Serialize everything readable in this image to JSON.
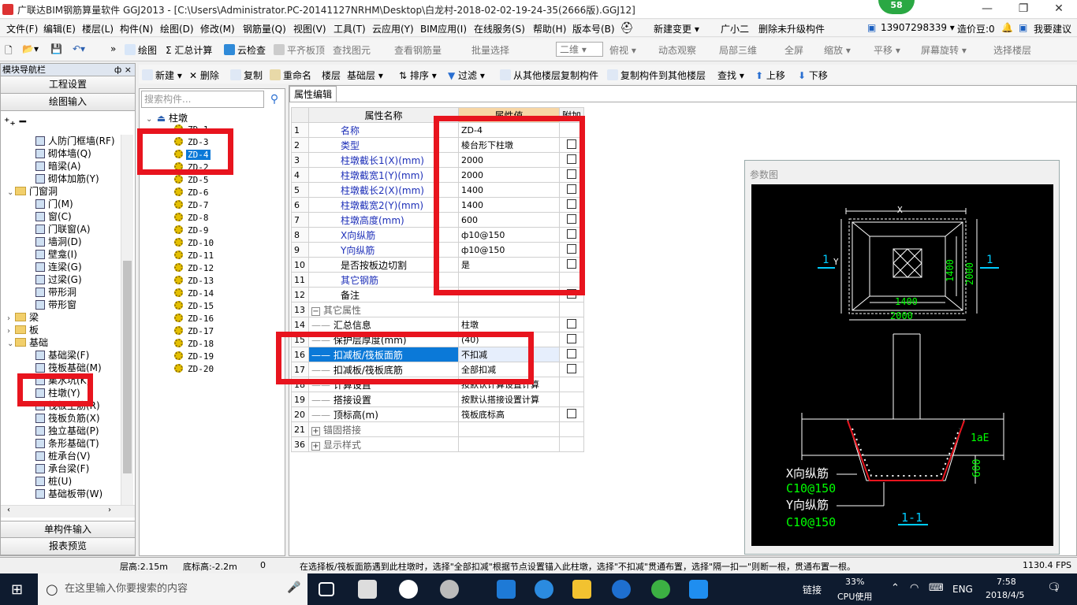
{
  "title_bar": {
    "title": "广联达BIM钢筋算量软件 GGJ2013 - [C:\\Users\\Administrator.PC-20141127NRHM\\Desktop\\白龙村-2018-02-02-19-24-35(2666版).GGJ12]",
    "badge": "58"
  },
  "menu": [
    "文件(F)",
    "编辑(E)",
    "楼层(L)",
    "构件(N)",
    "绘图(D)",
    "修改(M)",
    "钢筋量(Q)",
    "视图(V)",
    "工具(T)",
    "云应用(Y)",
    "BIM应用(I)",
    "在线服务(S)",
    "帮助(H)",
    "版本号(B)",
    "新建变更 ▾",
    "广小二",
    "删除未升级构件",
    "13907298339 ▾",
    "造价豆:0",
    "我要建议"
  ],
  "toolbar1": [
    "绘图",
    "Σ 汇总计算",
    "云检查",
    "平齐板顶",
    "查找图元",
    "查看钢筋量",
    "批量选择",
    "二维 ▾",
    "俯视 ▾",
    "动态观察",
    "局部三维",
    "全屏",
    "缩放 ▾",
    "平移 ▾",
    "屏幕旋转 ▾",
    "选择楼层"
  ],
  "toolbar2": [
    "新建 ▾",
    "删除",
    "复制",
    "重命名",
    "楼层",
    "基础层",
    "排序 ▾",
    "过滤 ▾",
    "从其他楼层复制构件",
    "复制构件到其他楼层",
    "查找 ▾",
    "上移",
    "下移"
  ],
  "left_nav": {
    "header": "模块导航栏",
    "pin": "ф ×",
    "buttons": [
      "工程设置",
      "绘图输入"
    ],
    "bottom_buttons": [
      "单构件输入",
      "报表预览"
    ],
    "tree": [
      {
        "label": "人防门框墙(RF)",
        "level": 2,
        "type": "item"
      },
      {
        "label": "砌体墙(Q)",
        "level": 2,
        "type": "item"
      },
      {
        "label": "暗梁(A)",
        "level": 2,
        "type": "item"
      },
      {
        "label": "砌体加筋(Y)",
        "level": 2,
        "type": "item"
      },
      {
        "label": "门窗洞",
        "level": 1,
        "type": "folder",
        "expand": "⌄"
      },
      {
        "label": "门(M)",
        "level": 2,
        "type": "item"
      },
      {
        "label": "窗(C)",
        "level": 2,
        "type": "item"
      },
      {
        "label": "门联窗(A)",
        "level": 2,
        "type": "item"
      },
      {
        "label": "墙洞(D)",
        "level": 2,
        "type": "item"
      },
      {
        "label": "壁龛(I)",
        "level": 2,
        "type": "item"
      },
      {
        "label": "连梁(G)",
        "level": 2,
        "type": "item"
      },
      {
        "label": "过梁(G)",
        "level": 2,
        "type": "item"
      },
      {
        "label": "带形洞",
        "level": 2,
        "type": "item"
      },
      {
        "label": "带形窗",
        "level": 2,
        "type": "item"
      },
      {
        "label": "梁",
        "level": 1,
        "type": "folder",
        "expand": "›"
      },
      {
        "label": "板",
        "level": 1,
        "type": "folder",
        "expand": "›"
      },
      {
        "label": "基础",
        "level": 1,
        "type": "folder",
        "expand": "⌄"
      },
      {
        "label": "基础梁(F)",
        "level": 2,
        "type": "item"
      },
      {
        "label": "筏板基础(M)",
        "level": 2,
        "type": "item"
      },
      {
        "label": "集水坑(K)",
        "level": 2,
        "type": "item"
      },
      {
        "label": "柱墩(Y)",
        "level": 2,
        "type": "item"
      },
      {
        "label": "筏板主筋(R)",
        "level": 2,
        "type": "item"
      },
      {
        "label": "筏板负筋(X)",
        "level": 2,
        "type": "item"
      },
      {
        "label": "独立基础(P)",
        "level": 2,
        "type": "item"
      },
      {
        "label": "条形基础(T)",
        "level": 2,
        "type": "item"
      },
      {
        "label": "桩承台(V)",
        "level": 2,
        "type": "item"
      },
      {
        "label": "承台梁(F)",
        "level": 2,
        "type": "item"
      },
      {
        "label": "桩(U)",
        "level": 2,
        "type": "item"
      },
      {
        "label": "基础板带(W)",
        "level": 2,
        "type": "item"
      }
    ]
  },
  "component_list": {
    "search_placeholder": "搜索构件...",
    "root": "柱墩",
    "items": [
      "ZD-1",
      "ZD-3",
      "ZD-4",
      "ZD-2",
      "ZD-5",
      "ZD-6",
      "ZD-7",
      "ZD-8",
      "ZD-9",
      "ZD-10",
      "ZD-11",
      "ZD-12",
      "ZD-13",
      "ZD-14",
      "ZD-15",
      "ZD-16",
      "ZD-17",
      "ZD-18",
      "ZD-19",
      "ZD-20"
    ],
    "selected": "ZD-4"
  },
  "property_editor": {
    "tab": "属性编辑",
    "headers": [
      "属性名称",
      "属性值",
      "附加"
    ],
    "rows": [
      {
        "num": "1",
        "name": "名称",
        "value": "ZD-4",
        "style": "blue",
        "check": false,
        "indent": 0
      },
      {
        "num": "2",
        "name": "类型",
        "value": "棱台形下柱墩",
        "style": "blue",
        "check": true,
        "indent": 0
      },
      {
        "num": "3",
        "name": "柱墩截长1(X)(mm)",
        "value": "2000",
        "style": "blue",
        "check": true,
        "indent": 0
      },
      {
        "num": "4",
        "name": "柱墩截宽1(Y)(mm)",
        "value": "2000",
        "style": "blue",
        "check": true,
        "indent": 0
      },
      {
        "num": "5",
        "name": "柱墩截长2(X)(mm)",
        "value": "1400",
        "style": "blue",
        "check": true,
        "indent": 0
      },
      {
        "num": "6",
        "name": "柱墩截宽2(Y)(mm)",
        "value": "1400",
        "style": "blue",
        "check": true,
        "indent": 0
      },
      {
        "num": "7",
        "name": "柱墩高度(mm)",
        "value": "600",
        "style": "blue",
        "check": true,
        "indent": 0
      },
      {
        "num": "8",
        "name": "X向纵筋",
        "value": "ф10@150",
        "style": "blue",
        "check": true,
        "indent": 0
      },
      {
        "num": "9",
        "name": "Y向纵筋",
        "value": "ф10@150",
        "style": "blue",
        "check": true,
        "indent": 0
      },
      {
        "num": "10",
        "name": "是否按板边切割",
        "value": "是",
        "style": "black",
        "check": true,
        "indent": 0
      },
      {
        "num": "11",
        "name": "其它钢筋",
        "value": "",
        "style": "blue",
        "check": false,
        "indent": 0
      },
      {
        "num": "12",
        "name": "备注",
        "value": "",
        "style": "black",
        "check": true,
        "indent": 0
      },
      {
        "num": "13",
        "name": "其它属性",
        "value": "",
        "style": "grey",
        "check": false,
        "indent": 0,
        "expand": "−"
      },
      {
        "num": "14",
        "name": "汇总信息",
        "value": "柱墩",
        "style": "black",
        "check": true,
        "indent": 1
      },
      {
        "num": "15",
        "name": "保护层厚度(mm)",
        "value": "(40)",
        "style": "black",
        "check": true,
        "indent": 1
      },
      {
        "num": "16",
        "name": "扣减板/筏板面筋",
        "value": "不扣减",
        "style": "black",
        "check": true,
        "indent": 1,
        "selected": true
      },
      {
        "num": "17",
        "name": "扣减板/筏板底筋",
        "value": "全部扣减",
        "style": "black",
        "check": true,
        "indent": 1
      },
      {
        "num": "18",
        "name": "计算设置",
        "value": "按默认计算设置计算",
        "style": "black",
        "check": false,
        "indent": 1
      },
      {
        "num": "19",
        "name": "搭接设置",
        "value": "按默认搭接设置计算",
        "style": "black",
        "check": false,
        "indent": 1
      },
      {
        "num": "20",
        "name": "顶标高(m)",
        "value": "筏板底标高",
        "style": "black",
        "check": true,
        "indent": 1
      },
      {
        "num": "21",
        "name": "锚固搭接",
        "value": "",
        "style": "grey",
        "check": false,
        "indent": 0,
        "expand": "+"
      },
      {
        "num": "36",
        "name": "显示样式",
        "value": "",
        "style": "grey",
        "check": false,
        "indent": 0,
        "expand": "+"
      }
    ]
  },
  "param_diagram": {
    "title": "参数图",
    "labels": {
      "x": "X",
      "y": "Y",
      "sec_left": "1",
      "sec_right": "1",
      "d1400v": "1400",
      "d2000v": "2000",
      "d1400h": "1400",
      "d2000h": "2000",
      "lae": "1aE",
      "h600": "600",
      "xbar": "X向纵筋",
      "xspec": "C10@150",
      "ybar": "Y向纵筋",
      "yspec": "C10@150",
      "section": "1-1"
    }
  },
  "status_bar": {
    "floor_height": "层高:2.15m",
    "bottom_elev": "底标高:-2.2m",
    "zero": "0",
    "hint": "在选择板/筏板面筋遇到此柱墩时，选择\"全部扣减\"根据节点设置锚入此柱墩，选择\"不扣减\"贯通布置，选择\"隔一扣一\"则断一根，贯通布置一根。",
    "fps": "1130.4 FPS"
  },
  "taskbar": {
    "search_placeholder": "在这里输入你要搜索的内容",
    "link": "链接",
    "cpu_pct": "33%",
    "cpu_label": "CPU使用",
    "lang": "ENG",
    "time": "7:58",
    "date": "2018/4/5",
    "notif": "1"
  },
  "colors": {
    "highlight": "#e8141e",
    "selection": "#0b79d8",
    "blue_text": "#1d2fb8"
  }
}
